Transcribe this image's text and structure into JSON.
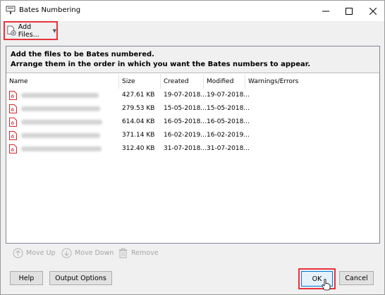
{
  "window": {
    "title": "Bates Numbering"
  },
  "toolbar": {
    "add_files_label": "Add Files..."
  },
  "panel": {
    "instruction_line1": "Add the files to be Bates numbered.",
    "instruction_line2": "Arrange them in the order in which you want the Bates numbers to appear."
  },
  "columns": [
    "Name",
    "Size",
    "Created",
    "Modified",
    "Warnings/Errors"
  ],
  "rows": [
    {
      "size": "427.61 KB",
      "created": "19-07-2018...",
      "modified": "19-07-2018..."
    },
    {
      "size": "279.53 KB",
      "created": "15-05-2018...",
      "modified": "15-05-2018..."
    },
    {
      "size": "614.04 KB",
      "created": "16-05-2018...",
      "modified": "16-05-2018..."
    },
    {
      "size": "371.14 KB",
      "created": "16-02-2019...",
      "modified": "16-02-2019..."
    },
    {
      "size": "312.40 KB",
      "created": "31-07-2018...",
      "modified": "31-07-2018..."
    }
  ],
  "list_actions": {
    "move_up": "Move Up",
    "move_down": "Move Down",
    "remove": "Remove"
  },
  "footer": {
    "help": "Help",
    "output_options": "Output Options",
    "ok": "OK",
    "cancel": "Cancel"
  },
  "colors": {
    "highlight": "#e8333c",
    "pdf_icon": "#d9262b",
    "ok_border": "#0078d7"
  }
}
